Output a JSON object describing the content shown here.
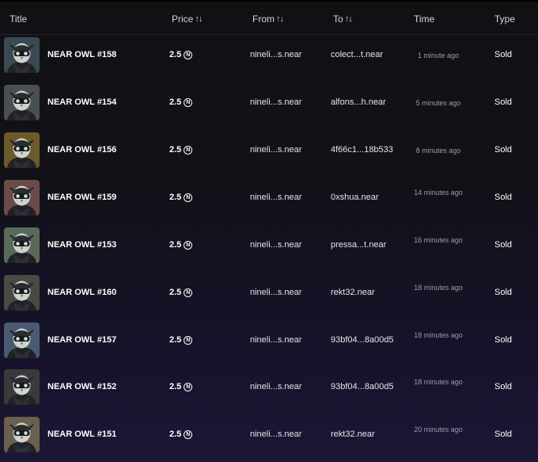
{
  "header": {
    "title": "Title",
    "price": "Price",
    "from": "From",
    "to": "To",
    "time": "Time",
    "type": "Type",
    "sort_glyph": "↑↓"
  },
  "colors": {
    "row_owl_bgs": [
      "#3b4a52",
      "#4a4f52",
      "#6b5a2a",
      "#6b4a4a",
      "#5a6a5a",
      "#4a4a44",
      "#4a5a70",
      "#3a3a3a",
      "#6a6050"
    ]
  },
  "rows": [
    {
      "title": "NEAR OWL #158",
      "price": "2.5",
      "currency_icon": "near-icon",
      "from": "nineli...s.near",
      "to": "colect...t.near",
      "time": "1 minute ago",
      "type": "Sold"
    },
    {
      "title": "NEAR OWL #154",
      "price": "2.5",
      "currency_icon": "near-icon",
      "from": "nineli...s.near",
      "to": "alfons...h.near",
      "time": "5 minutes ago",
      "type": "Sold"
    },
    {
      "title": "NEAR OWL #156",
      "price": "2.5",
      "currency_icon": "near-icon",
      "from": "nineli...s.near",
      "to": "4f66c1...18b533",
      "time": "8 minutes ago",
      "type": "Sold"
    },
    {
      "title": "NEAR OWL #159",
      "price": "2.5",
      "currency_icon": "near-icon",
      "from": "nineli...s.near",
      "to": "0xshua.near",
      "time": "14 minutes ago",
      "type": "Sold"
    },
    {
      "title": "NEAR OWL #153",
      "price": "2.5",
      "currency_icon": "near-icon",
      "from": "nineli...s.near",
      "to": "pressa...t.near",
      "time": "16 minutes ago",
      "type": "Sold"
    },
    {
      "title": "NEAR OWL #160",
      "price": "2.5",
      "currency_icon": "near-icon",
      "from": "nineli...s.near",
      "to": "rekt32.near",
      "time": "18 minutes ago",
      "type": "Sold"
    },
    {
      "title": "NEAR OWL #157",
      "price": "2.5",
      "currency_icon": "near-icon",
      "from": "nineli...s.near",
      "to": "93bf04...8a00d5",
      "time": "18 minutes ago",
      "type": "Sold"
    },
    {
      "title": "NEAR OWL #152",
      "price": "2.5",
      "currency_icon": "near-icon",
      "from": "nineli...s.near",
      "to": "93bf04...8a00d5",
      "time": "18 minutes ago",
      "type": "Sold"
    },
    {
      "title": "NEAR OWL #151",
      "price": "2.5",
      "currency_icon": "near-icon",
      "from": "nineli...s.near",
      "to": "rekt32.near",
      "time": "20 minutes ago",
      "type": "Sold"
    }
  ]
}
